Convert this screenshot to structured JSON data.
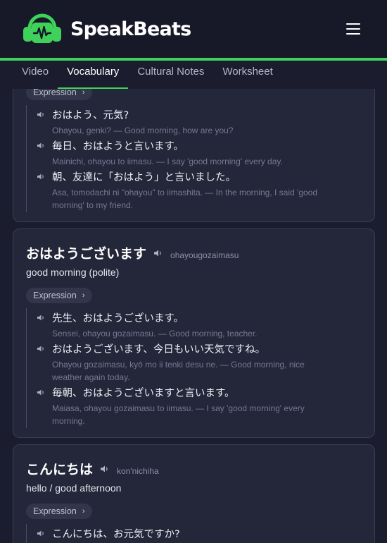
{
  "brand": {
    "name": "SpeakBeats",
    "accent_color": "#3ed25b"
  },
  "menu": {
    "icon": "hamburger-menu-icon"
  },
  "tabs": [
    {
      "label": "Video",
      "active": false
    },
    {
      "label": "Vocabulary",
      "active": true
    },
    {
      "label": "Cultural Notes",
      "active": false
    },
    {
      "label": "Worksheet",
      "active": false
    }
  ],
  "cards": [
    {
      "chip": "Expression",
      "examples": [
        {
          "jp": "おはよう、元気?",
          "tr": "Ohayou, genki? — Good morning, how are you?"
        },
        {
          "jp": "毎日、おはようと言います。",
          "tr": "Mainichi, ohayou to iimasu. — I say 'good morning' every day."
        },
        {
          "jp": "朝、友達に「おはよう」と言いました。",
          "tr_1": "Asa, tomodachi ni \"ohayou\" to iimashita. — In the morning, I said 'good",
          "tr_2": "morning' to my friend."
        }
      ]
    },
    {
      "word": "おはようございます",
      "romaji": "ohayougozaimasu",
      "meaning": "good morning (polite)",
      "chip": "Expression",
      "examples": [
        {
          "jp": "先生、おはようございます。",
          "tr": "Sensei, ohayou gozaimasu. — Good morning, teacher."
        },
        {
          "jp": "おはようございます、今日もいい天気ですね。",
          "tr_1": "Ohayou gozaimasu, kyō mo ii tenki desu ne. — Good morning, nice",
          "tr_2": "weather again today."
        },
        {
          "jp": "毎朝、おはようございますと言います。",
          "tr_1": "Maiasa, ohayou gozaimasu to iimasu. — I say 'good morning' every",
          "tr_2": "morning."
        }
      ]
    },
    {
      "word": "こんにちは",
      "romaji": "kon'nichiha",
      "meaning": "hello / good afternoon",
      "chip": "Expression",
      "examples": [
        {
          "jp": "こんにちは、お元気ですか?"
        }
      ]
    }
  ]
}
